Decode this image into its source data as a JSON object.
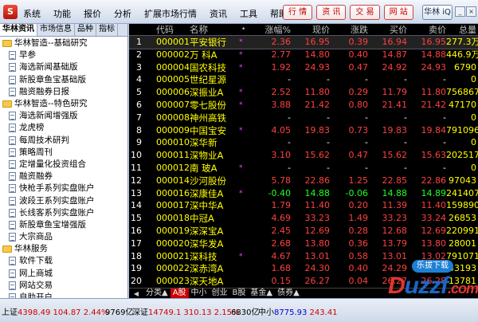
{
  "menu": {
    "items": [
      "系统",
      "功能",
      "报价",
      "分析",
      "扩展市场行情",
      "资讯",
      "工具",
      "帮助"
    ]
  },
  "quick_buttons": [
    "行 情",
    "资 讯",
    "交 易",
    "网 站"
  ],
  "brand_button": "华林 iQ",
  "app_icon": "S",
  "window_buttons": [
    "_",
    "□",
    "×"
  ],
  "sidebar": {
    "tabs": [
      "华林资讯",
      "市场信息",
      "品种",
      "指标"
    ],
    "nodes": [
      {
        "type": "group",
        "label": "华林智造--基础研究"
      },
      {
        "type": "leaf",
        "label": "早参"
      },
      {
        "type": "leaf",
        "label": "海选新闻基础版"
      },
      {
        "type": "leaf",
        "label": "新股章鱼宝基础版"
      },
      {
        "type": "leaf",
        "label": "融资融券日报"
      },
      {
        "type": "group",
        "label": "华林智造--特色研究"
      },
      {
        "type": "leaf",
        "label": "海选新闻增强版"
      },
      {
        "type": "leaf",
        "label": "龙虎榜"
      },
      {
        "type": "leaf",
        "label": "每周技术研判"
      },
      {
        "type": "leaf",
        "label": "策略周刊"
      },
      {
        "type": "leaf",
        "label": "定增量化投资组合"
      },
      {
        "type": "leaf",
        "label": "融资融券"
      },
      {
        "type": "leaf",
        "label": "快枪手系列实盘账户"
      },
      {
        "type": "leaf",
        "label": "波段王系列实盘账户"
      },
      {
        "type": "leaf",
        "label": "长线客系列实盘账户"
      },
      {
        "type": "leaf",
        "label": "新股章鱼宝增强版"
      },
      {
        "type": "leaf",
        "label": "大宗商品"
      },
      {
        "type": "group",
        "label": "华林服务"
      },
      {
        "type": "leaf",
        "label": "软件下载"
      },
      {
        "type": "leaf",
        "label": "网上商城"
      },
      {
        "type": "leaf",
        "label": "网站交易"
      },
      {
        "type": "leaf",
        "label": "自助开户"
      }
    ]
  },
  "quotes": {
    "columns": [
      "代码",
      "名称",
      "•",
      "涨幅%",
      "现价",
      "涨跌",
      "买价",
      "卖价",
      "总量"
    ],
    "rows": [
      {
        "idx": "1",
        "code": "000001",
        "name": "平安银行",
        "star": "*",
        "pct": "2.36",
        "price": "16.95",
        "chg": "0.39",
        "bid": "16.94",
        "ask": "16.95",
        "vol": "277.3万",
        "dir": "up",
        "selected": true
      },
      {
        "idx": "2",
        "code": "000002",
        "name": "万 科A",
        "star": "*",
        "pct": "2.77",
        "price": "14.80",
        "chg": "0.40",
        "bid": "14.87",
        "ask": "14.88",
        "vol": "446.9万",
        "dir": "up"
      },
      {
        "idx": "3",
        "code": "000004",
        "name": "国农科技",
        "star": "*",
        "pct": "1.92",
        "price": "24.93",
        "chg": "0.47",
        "bid": "24.92",
        "ask": "24.93",
        "vol": "6790",
        "dir": "up"
      },
      {
        "idx": "4",
        "code": "000005",
        "name": "世纪星源",
        "star": "",
        "pct": "-",
        "price": "-",
        "chg": "-",
        "bid": "-",
        "ask": "-",
        "vol": "0",
        "dir": "flat"
      },
      {
        "idx": "5",
        "code": "000006",
        "name": "深振业A",
        "star": "*",
        "pct": "2.52",
        "price": "11.80",
        "chg": "0.29",
        "bid": "11.79",
        "ask": "11.80",
        "vol": "756867",
        "dir": "up"
      },
      {
        "idx": "6",
        "code": "000007",
        "name": "零七股份",
        "star": "*",
        "pct": "3.88",
        "price": "21.42",
        "chg": "0.80",
        "bid": "21.41",
        "ask": "21.42",
        "vol": "47170",
        "dir": "up"
      },
      {
        "idx": "7",
        "code": "000008",
        "name": "神州高铁",
        "star": "",
        "pct": "-",
        "price": "-",
        "chg": "-",
        "bid": "-",
        "ask": "-",
        "vol": "0",
        "dir": "flat"
      },
      {
        "idx": "8",
        "code": "000009",
        "name": "中国宝安",
        "star": "*",
        "pct": "4.05",
        "price": "19.83",
        "chg": "0.73",
        "bid": "19.83",
        "ask": "19.84",
        "vol": "791096",
        "dir": "up"
      },
      {
        "idx": "9",
        "code": "000010",
        "name": "深华新",
        "star": "",
        "pct": "-",
        "price": "-",
        "chg": "-",
        "bid": "-",
        "ask": "-",
        "vol": "0",
        "dir": "flat"
      },
      {
        "idx": "10",
        "code": "000011",
        "name": "深物业A",
        "star": "",
        "pct": "3.10",
        "price": "15.62",
        "chg": "0.47",
        "bid": "15.62",
        "ask": "15.63",
        "vol": "202517",
        "dir": "up"
      },
      {
        "idx": "11",
        "code": "000012",
        "name": "南 玻A",
        "star": "*",
        "pct": "-",
        "price": "-",
        "chg": "-",
        "bid": "-",
        "ask": "-",
        "vol": "0",
        "dir": "flat"
      },
      {
        "idx": "12",
        "code": "000014",
        "name": "沙河股份",
        "star": "",
        "pct": "5.78",
        "price": "22.86",
        "chg": "1.25",
        "bid": "22.85",
        "ask": "22.86",
        "vol": "97043",
        "dir": "up"
      },
      {
        "idx": "13",
        "code": "000016",
        "name": "深康佳A",
        "star": "*",
        "pct": "-0.40",
        "price": "14.88",
        "chg": "-0.06",
        "bid": "14.88",
        "ask": "14.89",
        "vol": "241407",
        "dir": "dn"
      },
      {
        "idx": "14",
        "code": "000017",
        "name": "深中华A",
        "star": "",
        "pct": "1.79",
        "price": "11.40",
        "chg": "0.20",
        "bid": "11.39",
        "ask": "11.40",
        "vol": "159890",
        "dir": "up"
      },
      {
        "idx": "15",
        "code": "000018",
        "name": "中冠A",
        "star": "",
        "pct": "4.69",
        "price": "33.23",
        "chg": "1.49",
        "bid": "33.23",
        "ask": "33.24",
        "vol": "26853",
        "dir": "up"
      },
      {
        "idx": "16",
        "code": "000019",
        "name": "深深宝A",
        "star": "",
        "pct": "2.45",
        "price": "12.69",
        "chg": "0.28",
        "bid": "12.68",
        "ask": "12.69",
        "vol": "220991",
        "dir": "up"
      },
      {
        "idx": "17",
        "code": "000020",
        "name": "深华发A",
        "star": "",
        "pct": "2.68",
        "price": "13.80",
        "chg": "0.36",
        "bid": "13.79",
        "ask": "13.80",
        "vol": "28001",
        "dir": "up"
      },
      {
        "idx": "18",
        "code": "000021",
        "name": "深科技",
        "star": "*",
        "pct": "4.67",
        "price": "13.01",
        "chg": "0.58",
        "bid": "13.01",
        "ask": "13.02",
        "vol": "791071",
        "dir": "up"
      },
      {
        "idx": "19",
        "code": "000022",
        "name": "深赤湾A",
        "star": "",
        "pct": "1.68",
        "price": "24.30",
        "chg": "0.40",
        "bid": "24.29",
        "ask": "24.30",
        "vol": "43193",
        "dir": "up"
      },
      {
        "idx": "20",
        "code": "000023",
        "name": "深天地A",
        "star": "",
        "pct": "0.15",
        "price": "26.27",
        "chg": "0.04",
        "bid": "26.27",
        "ask": "26.28",
        "vol": "13781",
        "dir": "up"
      }
    ]
  },
  "category_tabs": [
    {
      "label": "分类▲",
      "active": false
    },
    {
      "label": "A股",
      "active": true
    },
    {
      "label": "中小",
      "active": false
    },
    {
      "label": "创业",
      "active": false
    },
    {
      "label": "B股",
      "active": false
    },
    {
      "label": "基金▲",
      "active": false
    },
    {
      "label": "债券▲",
      "active": false
    }
  ],
  "status": {
    "sh_label": "上证",
    "sh_index": "4398.49",
    "sh_chg": "104.87",
    "sh_pct": "2.44%",
    "sh_amount": "9769亿",
    "sz_label": "深证",
    "sz_index": "14749.1",
    "sz_chg": "310.13",
    "sz_pct": "2.15%",
    "sz_amount": "6830亿",
    "zx_label": "中小",
    "zx_index": "8775.93",
    "zx_chg": "243.41"
  },
  "watermark": {
    "badge": "乐拔下载",
    "text_blue": "uzzf",
    "text_red": ".com",
    "prefix": "D"
  }
}
